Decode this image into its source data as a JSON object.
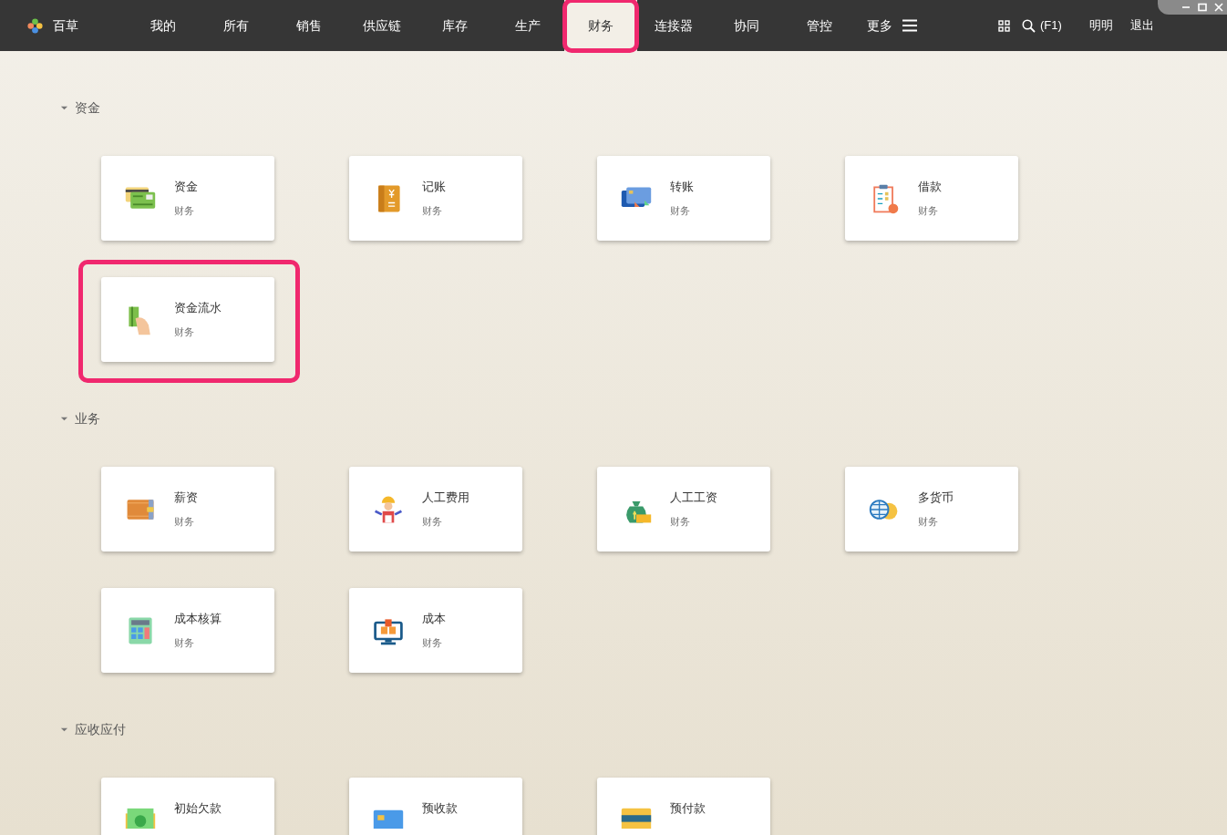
{
  "app": {
    "name": "百草"
  },
  "nav": [
    {
      "label": "我的",
      "selected": false,
      "highlighted": false
    },
    {
      "label": "所有",
      "selected": false,
      "highlighted": false
    },
    {
      "label": "销售",
      "selected": false,
      "highlighted": false
    },
    {
      "label": "供应链",
      "selected": false,
      "highlighted": false
    },
    {
      "label": "库存",
      "selected": false,
      "highlighted": false
    },
    {
      "label": "生产",
      "selected": false,
      "highlighted": false
    },
    {
      "label": "财务",
      "selected": true,
      "highlighted": true
    },
    {
      "label": "连接器",
      "selected": false,
      "highlighted": false
    },
    {
      "label": "协同",
      "selected": false,
      "highlighted": false
    },
    {
      "label": "管控",
      "selected": false,
      "highlighted": false
    }
  ],
  "more": {
    "label": "更多"
  },
  "search": {
    "shortcut": "(F1)"
  },
  "user": {
    "name": "明明",
    "logout": "退出"
  },
  "sections": [
    {
      "title": "资金",
      "expanded": true,
      "cards": [
        {
          "title": "资金",
          "subtitle": "财务",
          "highlighted": false
        },
        {
          "title": "记账",
          "subtitle": "财务",
          "highlighted": false
        },
        {
          "title": "转账",
          "subtitle": "财务",
          "highlighted": false
        },
        {
          "title": "借款",
          "subtitle": "财务",
          "highlighted": false
        },
        {
          "title": "资金流水",
          "subtitle": "财务",
          "highlighted": true
        }
      ]
    },
    {
      "title": "业务",
      "expanded": true,
      "cards": [
        {
          "title": "薪资",
          "subtitle": "财务",
          "highlighted": false
        },
        {
          "title": "人工费用",
          "subtitle": "财务",
          "highlighted": false
        },
        {
          "title": "人工工资",
          "subtitle": "财务",
          "highlighted": false
        },
        {
          "title": "多货币",
          "subtitle": "财务",
          "highlighted": false
        },
        {
          "title": "成本核算",
          "subtitle": "财务",
          "highlighted": false
        },
        {
          "title": "成本",
          "subtitle": "财务",
          "highlighted": false
        }
      ]
    },
    {
      "title": "应收应付",
      "expanded": true,
      "cards": [
        {
          "title": "初始欠款",
          "highlighted": false
        },
        {
          "title": "预收款",
          "highlighted": false
        },
        {
          "title": "预付款",
          "highlighted": false
        }
      ]
    }
  ]
}
